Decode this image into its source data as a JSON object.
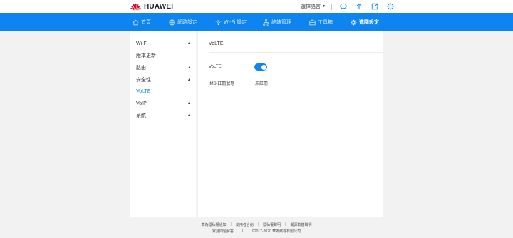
{
  "header": {
    "brand": "HUAWEI",
    "brand_color": "#cf0a2c",
    "language_label": "選擇語言",
    "icons": [
      "chat-icon",
      "upload-arrow-icon",
      "exit-icon",
      "loading-icon"
    ]
  },
  "nav": {
    "bg_color": "#0d84f0",
    "items": [
      {
        "label": "首頁",
        "icon": "home-icon"
      },
      {
        "label": "網路設定",
        "icon": "globe-icon"
      },
      {
        "label": "Wi-Fi 設定",
        "icon": "wifi-icon"
      },
      {
        "label": "終端管理",
        "icon": "network-icon"
      },
      {
        "label": "工具箱",
        "icon": "toolbox-icon"
      },
      {
        "label": "進階設定",
        "icon": "gear-icon"
      }
    ],
    "active_index": 5
  },
  "sidebar": {
    "items": [
      {
        "label": "Wi-Fi",
        "arrow": "▲"
      },
      {
        "label": "版本更新",
        "arrow": ""
      },
      {
        "label": "路由",
        "arrow": "▲"
      },
      {
        "label": "安全性",
        "arrow": "▲"
      },
      {
        "label": "VoLTE",
        "arrow": ""
      },
      {
        "label": "VoIP",
        "arrow": "▲"
      },
      {
        "label": "系統",
        "arrow": "▲"
      }
    ],
    "active_index": 4
  },
  "main": {
    "title": "VoLTE",
    "volte_label": "VoLTE",
    "volte_enabled": true,
    "ims_label": "IMS 註冊狀態",
    "ims_value": "未註冊"
  },
  "footer": {
    "links": [
      "華為隱私權通知",
      "使用者合約",
      "隱私權聲明",
      "開源軟體聲明"
    ],
    "faq": "常見問題解答",
    "copyright": "©2017-2020 華為終端有限公司"
  }
}
